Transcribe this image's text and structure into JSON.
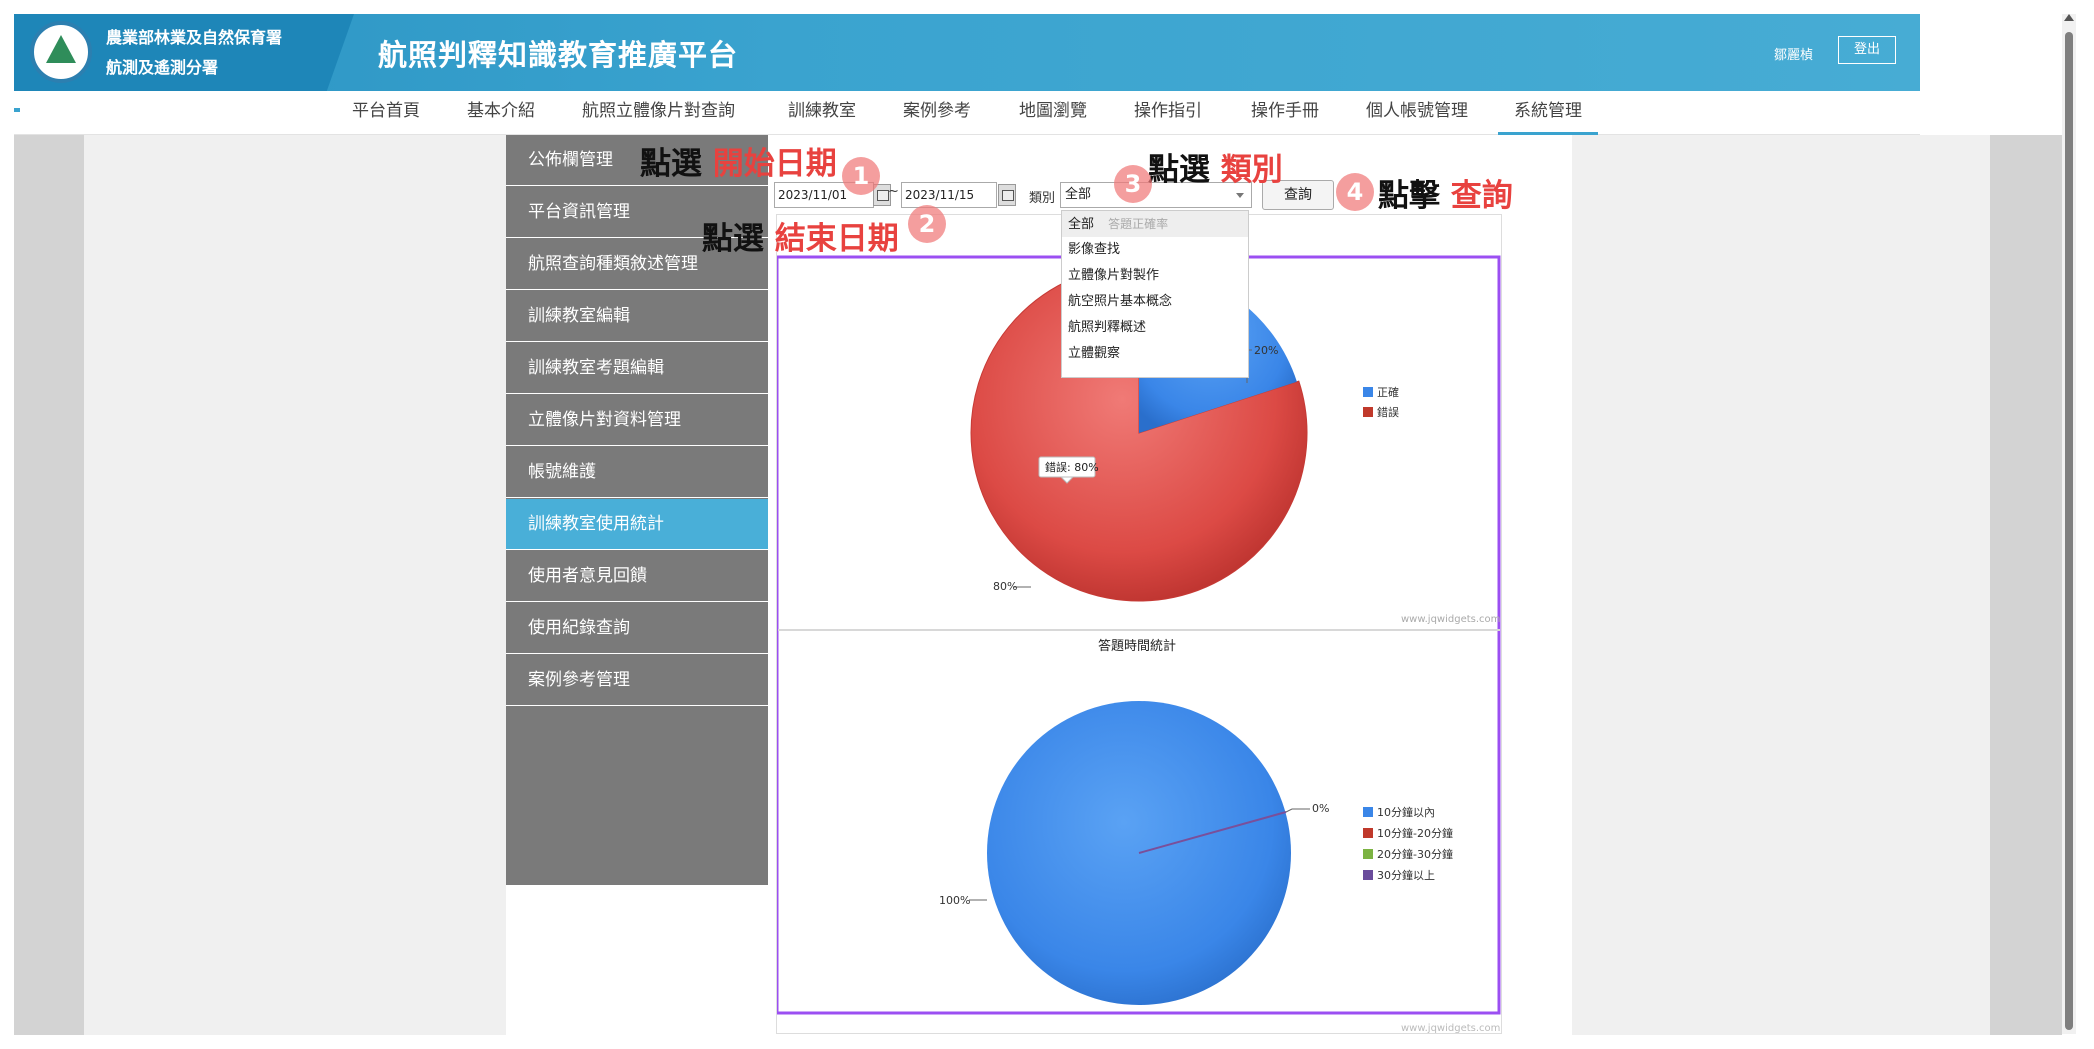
{
  "header": {
    "org_name_line1": "農業部林業及自然保育署",
    "org_name_line2": "航測及遙測分署",
    "platform_title": "航照判釋知識教育推廣平台",
    "user_name": "鄒麗楨",
    "logout_label": "登出"
  },
  "nav": {
    "items": [
      {
        "label": "平台首頁"
      },
      {
        "label": "基本介紹"
      },
      {
        "label": "航照立體像片對查詢"
      },
      {
        "label": "訓練教室"
      },
      {
        "label": "案例參考"
      },
      {
        "label": "地圖瀏覽"
      },
      {
        "label": "操作指引"
      },
      {
        "label": "操作手冊"
      },
      {
        "label": "個人帳號管理"
      },
      {
        "label": "系統管理"
      }
    ],
    "active_index": 9
  },
  "sidebar": {
    "items": [
      {
        "label": "公佈欄管理"
      },
      {
        "label": "平台資訊管理"
      },
      {
        "label": "航照查詢種類敘述管理"
      },
      {
        "label": "訓練教室編輯"
      },
      {
        "label": "訓練教室考題編輯"
      },
      {
        "label": "立體像片對資料管理"
      },
      {
        "label": "帳號維護"
      },
      {
        "label": "訓練教室使用統計"
      },
      {
        "label": "使用者意見回饋"
      },
      {
        "label": "使用紀錄查詢"
      },
      {
        "label": "案例參考管理"
      }
    ],
    "active_index": 7
  },
  "filters": {
    "start_date": "2023/11/01",
    "end_date": "2023/11/15",
    "separator": "~",
    "category_label": "類別",
    "category_value": "全部",
    "query_label": "查詢"
  },
  "dropdown": {
    "options": [
      {
        "label": "全部",
        "hint": "答題正確率"
      },
      {
        "label": "影像查找"
      },
      {
        "label": "立體像片對製作"
      },
      {
        "label": "航空照片基本概念"
      },
      {
        "label": "航照判釋概述"
      },
      {
        "label": "立體觀察"
      }
    ]
  },
  "annotations": {
    "step1": {
      "prefix": "點選",
      "highlight": "開始日期",
      "number": "1"
    },
    "step2": {
      "prefix": "點選",
      "highlight": "結束日期",
      "number": "2"
    },
    "step3": {
      "prefix": "點選",
      "highlight": "類別",
      "number": "3"
    },
    "step4": {
      "prefix": "點擊",
      "highlight": "查詢",
      "number": "4"
    }
  },
  "chart_data": [
    {
      "type": "pie",
      "title": "答題正確率",
      "series": [
        {
          "name": "正確",
          "value": 20,
          "color": "#3a86e8",
          "label": "20%"
        },
        {
          "name": "錯誤",
          "value": 80,
          "color": "#d63b3b",
          "label": "80%"
        }
      ],
      "tooltip": "錯誤: 80%",
      "legend_position": "right",
      "credit": "www.jqwidgets.com"
    },
    {
      "type": "pie",
      "title": "答題時間統計",
      "series": [
        {
          "name": "10分鐘以內",
          "value": 100,
          "color": "#3a86e8",
          "label": "100%"
        },
        {
          "name": "10分鐘-20分鐘",
          "value": 0,
          "color": "#c0392b",
          "label": "0%"
        },
        {
          "name": "20分鐘-30分鐘",
          "value": 0,
          "color": "#7cb342",
          "label": ""
        },
        {
          "name": "30分鐘以上",
          "value": 0,
          "color": "#6a4c9c",
          "label": ""
        }
      ],
      "legend_position": "right",
      "credit": "www.jqwidgets.com"
    }
  ]
}
